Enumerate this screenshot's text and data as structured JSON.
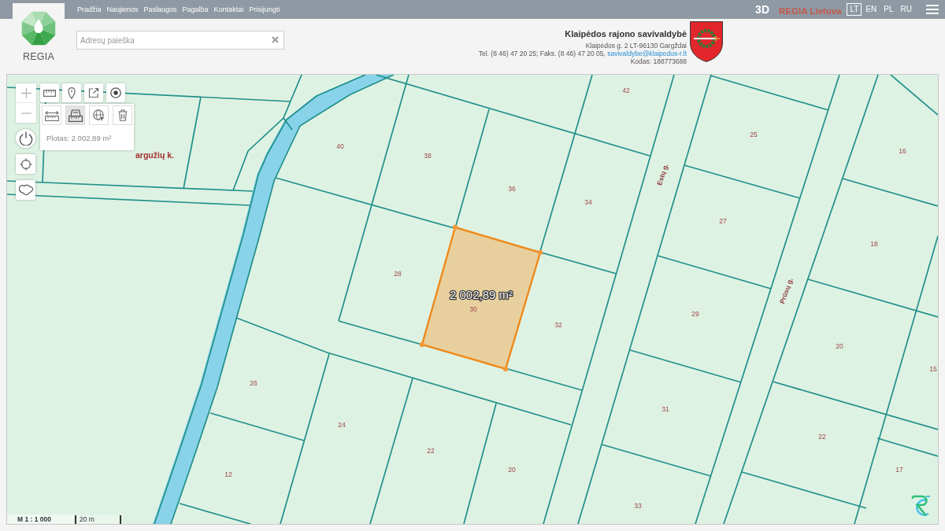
{
  "top_bar": {
    "nav": [
      {
        "label": "Pradžia"
      },
      {
        "label": "Naujienos"
      },
      {
        "label": "Paslaugos"
      },
      {
        "label": "Pagalba"
      },
      {
        "label": "Kontaktai"
      },
      {
        "label": "Prisijungti"
      }
    ],
    "mode": "3D",
    "brand": "REGIA Lietuva",
    "languages": [
      {
        "label": "LT",
        "selected": true
      },
      {
        "label": "EN",
        "selected": false
      },
      {
        "label": "PL",
        "selected": false
      },
      {
        "label": "RU",
        "selected": false
      }
    ]
  },
  "logo": {
    "text": "REGIA"
  },
  "search": {
    "placeholder": "Adresų paieška"
  },
  "municipality": {
    "name": "Klaipėdos rajono savivaldybė",
    "address": "Klaipėdos g. 2 LT-96130 Gargždai",
    "contacts": "Tel. (8 46) 47 20 25; Faks. (8 46) 47 20 05,",
    "email": "savivaldybe@klaipedos-r.lt",
    "code": "Kodas: 188773688"
  },
  "map": {
    "tools": [
      {
        "kind": "distance",
        "selected": false
      },
      {
        "kind": "area",
        "selected": true
      },
      {
        "kind": "select",
        "selected": false
      },
      {
        "kind": "delete",
        "selected": false
      }
    ],
    "measurement": "Plotas: 2 002,89 m²",
    "area_label": "2 002,89 m²",
    "village_label": "argužių k.",
    "streets": [
      {
        "name": "Estų g."
      },
      {
        "name": "Prūsų g."
      }
    ],
    "parcels": [
      {
        "number": "42"
      },
      {
        "number": "25"
      },
      {
        "number": "40"
      },
      {
        "number": "16"
      },
      {
        "number": "38"
      },
      {
        "number": "36"
      },
      {
        "number": "34"
      },
      {
        "number": "27"
      },
      {
        "number": "18"
      },
      {
        "number": "28"
      },
      {
        "number": "30"
      },
      {
        "number": "29"
      },
      {
        "number": "32"
      },
      {
        "number": "20"
      },
      {
        "number": "15"
      },
      {
        "number": "26"
      },
      {
        "number": "31"
      },
      {
        "number": "24"
      },
      {
        "number": "22"
      },
      {
        "number": "22"
      },
      {
        "number": "20"
      },
      {
        "number": "17"
      },
      {
        "number": "12"
      },
      {
        "number": "33"
      }
    ],
    "scale": {
      "ratio": "M 1 : 1 000",
      "bar": "20 m"
    }
  }
}
